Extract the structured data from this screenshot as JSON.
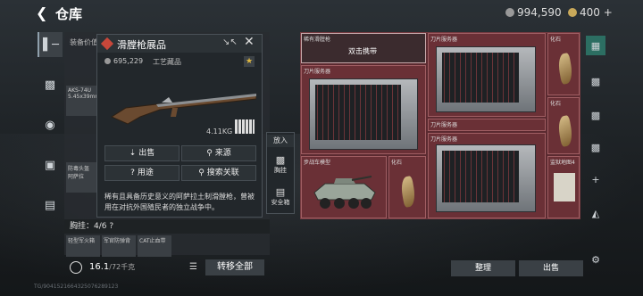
{
  "header": {
    "back_icon": "back-arrow-icon",
    "title": "仓库",
    "currency1": "994,590",
    "currency2": "400",
    "currency2_plus": "+"
  },
  "left_panel": {
    "header": "装备价值",
    "gun_slot": {
      "name": "AKS-74U",
      "sub": "5.45x39mm"
    },
    "slot2": {
      "name": "防毒头盔",
      "sub": "阿萨拉"
    },
    "chest_label": "胸挂：4/6",
    "chest_help": "?",
    "chest_items": [
      {
        "label": "轻型军火箱"
      },
      {
        "label": "军官防弹背"
      },
      {
        "label": "CAT止血带"
      }
    ],
    "weight_main": "16.1",
    "weight_total": "/72千克",
    "transfer_button": "转移全部",
    "status_text": "TG/9041521664325076289123"
  },
  "popup": {
    "name": "滑膛枪展品",
    "price": "695,229",
    "tag": "工艺藏品",
    "star": "★",
    "weight": "4.11KG",
    "buttons": [
      "出售",
      "来源",
      "用途",
      "搜索关联"
    ],
    "description": "稀有且具备历史意义的阿萨拉土制滑膛枪，曾被用在对抗外国殖民者的独立战争中。"
  },
  "side_menu": {
    "header": "放入",
    "items": [
      "胸挂",
      "安全箱"
    ]
  },
  "storage": {
    "cells": [
      {
        "label": "稀有滑膛枪",
        "hint": "双击携带"
      },
      {
        "label": "刀片服务器"
      },
      {
        "label": "化石"
      },
      {
        "label": "刀片服务器"
      },
      {
        "label": "刀片服务器"
      },
      {
        "label": "化石"
      },
      {
        "label": "步战车模型"
      },
      {
        "label": "化石"
      },
      {
        "label": "刀片服务器"
      },
      {
        "label": "监狱地图4"
      }
    ],
    "sort_button": "整理",
    "sell_button": "出售"
  }
}
